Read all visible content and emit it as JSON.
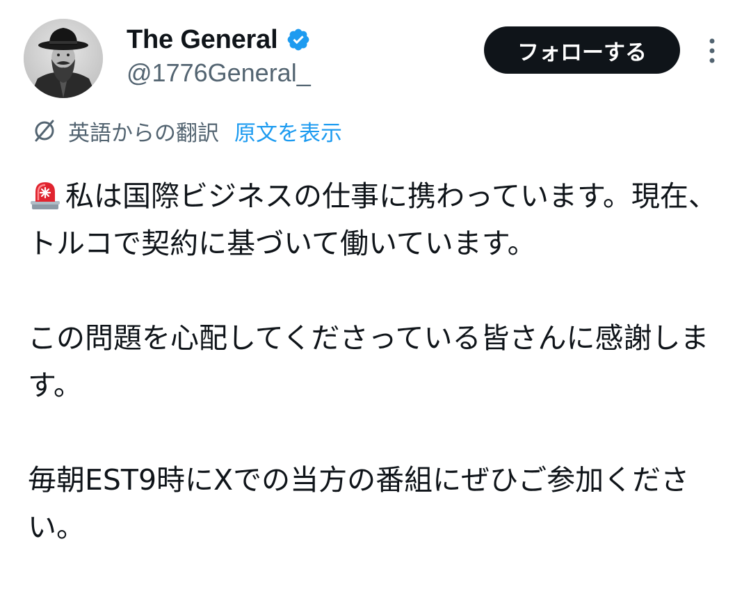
{
  "author": {
    "display_name": "The General",
    "handle": "@1776General_",
    "verified": true,
    "verified_icon": "verified-badge-icon",
    "avatar_icon": "avatar-portrait"
  },
  "actions": {
    "follow_label": "フォローする",
    "more_icon": "more-vertical-icon"
  },
  "translation": {
    "icon": "translate-icon",
    "translated_from": "英語からの翻訳",
    "show_original": "原文を表示"
  },
  "tweet": {
    "lead_icon": "siren-icon",
    "paragraphs": [
      "私は国際ビジネスの仕事に携わっています。現在、トルコで契約に基づいて働いています。",
      "この問題を心配してくださっている皆さんに感謝します。",
      "毎朝EST9時にXでの当方の番組にぜひご参加ください。"
    ]
  },
  "colors": {
    "text_primary": "#0f1419",
    "text_secondary": "#536471",
    "link": "#1d9bf0",
    "verified": "#1d9bf0",
    "follow_bg": "#0f1419"
  }
}
